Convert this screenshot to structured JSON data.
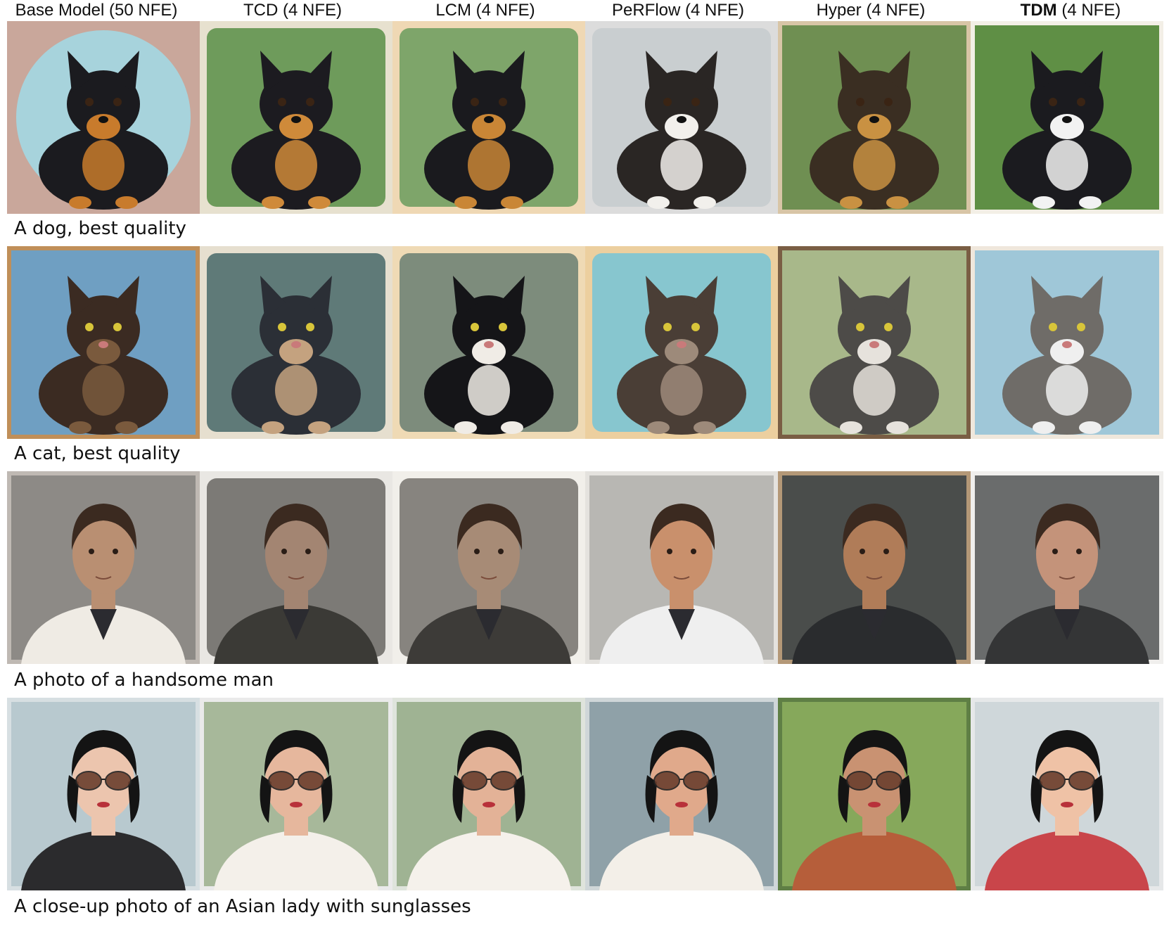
{
  "columns": [
    {
      "label": "Base Model (50 NFE)",
      "bold": ""
    },
    {
      "label": "TCD (4 NFE)",
      "bold": ""
    },
    {
      "label": "LCM (4 NFE)",
      "bold": ""
    },
    {
      "label": "PeRFlow (4 NFE)",
      "bold": ""
    },
    {
      "label": "Hyper (4 NFE)",
      "bold": ""
    },
    {
      "label": " (4 NFE)",
      "bold": "TDM"
    }
  ],
  "rows": [
    {
      "caption": "A dog, best quality",
      "subject": "dog"
    },
    {
      "caption": "A cat, best quality",
      "subject": "cat"
    },
    {
      "caption": "A photo of a handsome man",
      "subject": "man"
    },
    {
      "caption": "A close-up photo of an Asian lady with sunglasses",
      "subject": "lady"
    }
  ],
  "tiles": {
    "dog": [
      {
        "bg": "#c9a79b",
        "inner": "#a7d3dc",
        "body": "#1b1b1f",
        "accent": "#c87b2c",
        "frame": "circle"
      },
      {
        "bg": "#e7e1cf",
        "inner": "#6e9b5b",
        "body": "#1c1b20",
        "accent": "#cf8a3a",
        "frame": "rounded"
      },
      {
        "bg": "#efd8b4",
        "inner": "#7ea56a",
        "body": "#1a1a1e",
        "accent": "#c98636",
        "frame": "rounded"
      },
      {
        "bg": "#dcdcdc",
        "inner": "#c9ced0",
        "body": "#2a2624",
        "accent": "#f2f0ec",
        "frame": "rounded"
      },
      {
        "bg": "#d8c5a6",
        "inner": "#6f8f52",
        "body": "#3a2e22",
        "accent": "#c99142",
        "frame": "square"
      },
      {
        "bg": "#f3efe6",
        "inner": "#5f8f45",
        "body": "#1b1b1f",
        "accent": "#f2f2f2",
        "frame": "square"
      }
    ],
    "cat": [
      {
        "bg": "#c08f59",
        "inner": "#6f9fc2",
        "body": "#3b2b22",
        "accent": "#7a5a3d",
        "frame": "square"
      },
      {
        "bg": "#e6dfcf",
        "inner": "#5f7a78",
        "body": "#2b2f36",
        "accent": "#c4a27f",
        "frame": "rounded"
      },
      {
        "bg": "#efdab5",
        "inner": "#7d8c7c",
        "body": "#151518",
        "accent": "#f0ece6",
        "frame": "rounded"
      },
      {
        "bg": "#eccf9f",
        "inner": "#87c6cf",
        "body": "#4a3e36",
        "accent": "#9d8a7a",
        "frame": "rounded"
      },
      {
        "bg": "#7a5e44",
        "inner": "#a8b88a",
        "body": "#4d4b48",
        "accent": "#e6e2dc",
        "frame": "square"
      },
      {
        "bg": "#efe7dc",
        "inner": "#9fc7d8",
        "body": "#6f6c68",
        "accent": "#efefef",
        "frame": "square"
      }
    ],
    "man": [
      {
        "bg": "#bfb9b3",
        "inner": "#8d8a86",
        "body": "#efebe4",
        "accent": "#b98f72",
        "frame": "square"
      },
      {
        "bg": "#e9e7e3",
        "inner": "#7c7a76",
        "body": "#3b3a36",
        "accent": "#a38572",
        "frame": "rounded"
      },
      {
        "bg": "#f1efea",
        "inner": "#87847f",
        "body": "#3d3b38",
        "accent": "#a78b76",
        "frame": "rounded"
      },
      {
        "bg": "#e4e2de",
        "inner": "#b8b7b3",
        "body": "#efefef",
        "accent": "#c9906c",
        "frame": "square"
      },
      {
        "bg": "#b49877",
        "inner": "#4a4d4b",
        "body": "#2a2c2e",
        "accent": "#b07c58",
        "frame": "square"
      },
      {
        "bg": "#f0efed",
        "inner": "#6a6c6c",
        "body": "#343536",
        "accent": "#c4937a",
        "frame": "square"
      }
    ],
    "lady": [
      {
        "bg": "#d7dfe2",
        "inner": "#b8c9cf",
        "body": "#2b2b2d",
        "accent": "#ecc5ae",
        "frame": "square"
      },
      {
        "bg": "#eaeaea",
        "inner": "#a7b89a",
        "body": "#f4f0ea",
        "accent": "#e6b79d",
        "frame": "square"
      },
      {
        "bg": "#dfe4dc",
        "inner": "#9fb393",
        "body": "#f5f1eb",
        "accent": "#e3b297",
        "frame": "square"
      },
      {
        "bg": "#cfd6d8",
        "inner": "#8fa1a8",
        "body": "#f3efe8",
        "accent": "#e0a98b",
        "frame": "square"
      },
      {
        "bg": "#5f7f45",
        "inner": "#86a85b",
        "body": "#b65e3a",
        "accent": "#c99272",
        "frame": "square"
      },
      {
        "bg": "#e6e8e9",
        "inner": "#cfd7da",
        "body": "#c9454a",
        "accent": "#efc2a6",
        "frame": "square"
      }
    ]
  }
}
